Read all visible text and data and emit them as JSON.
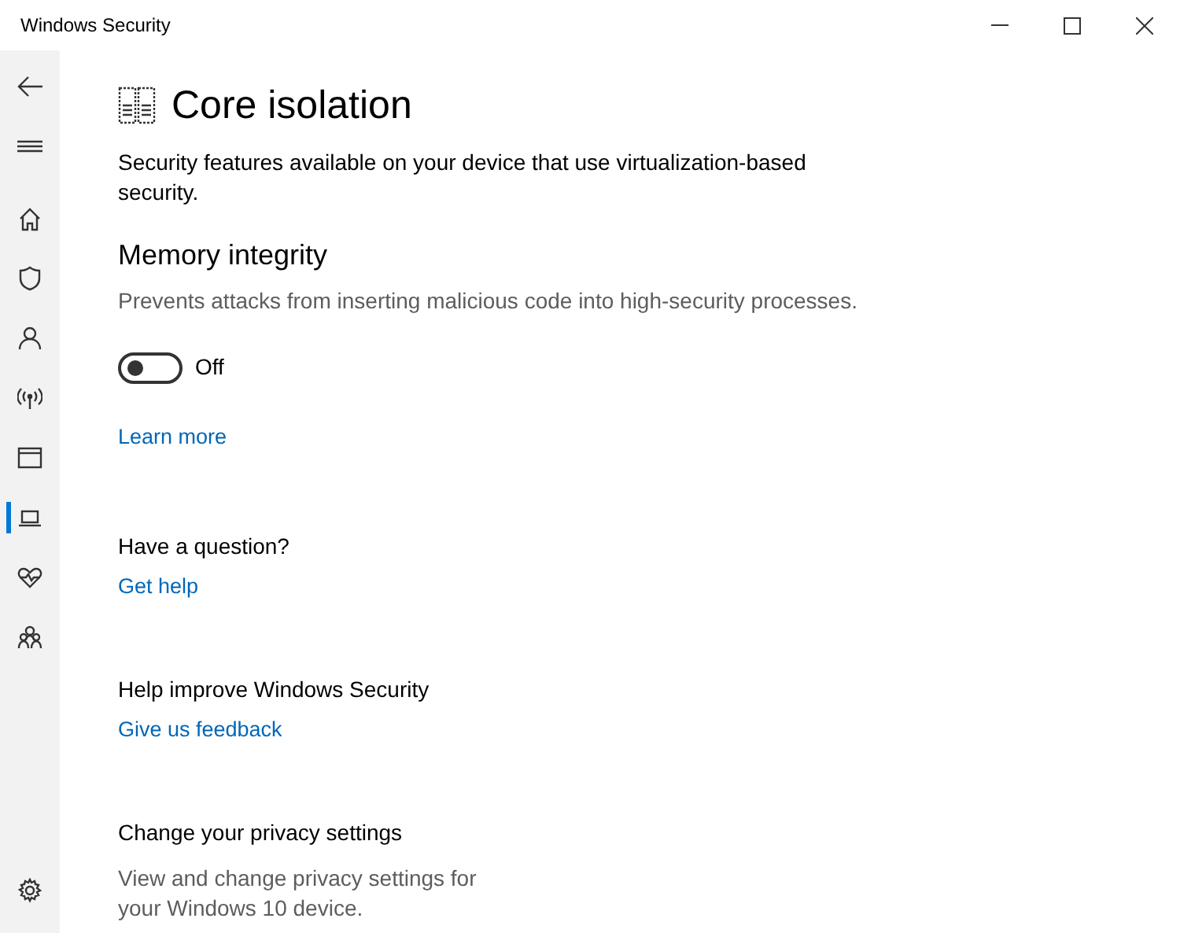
{
  "window": {
    "title": "Windows Security"
  },
  "sidebar": {
    "items": [
      {
        "selected": false
      },
      {
        "selected": false
      },
      {
        "selected": false
      },
      {
        "selected": false
      },
      {
        "selected": false
      },
      {
        "selected": true
      },
      {
        "selected": false
      },
      {
        "selected": false
      }
    ]
  },
  "page": {
    "title": "Core isolation",
    "description": "Security features available on your device that use virtualization-based security."
  },
  "memory_integrity": {
    "heading": "Memory integrity",
    "description": "Prevents attacks from inserting malicious code into high-security processes.",
    "toggle": {
      "on": false,
      "label": "Off"
    },
    "link": "Learn more"
  },
  "sections": [
    {
      "heading": "Have a question?",
      "link": "Get help"
    },
    {
      "heading": "Help improve Windows Security",
      "link": "Give us feedback"
    },
    {
      "heading": "Change your privacy settings",
      "text": "View and change privacy settings for your Windows 10 device."
    }
  ]
}
